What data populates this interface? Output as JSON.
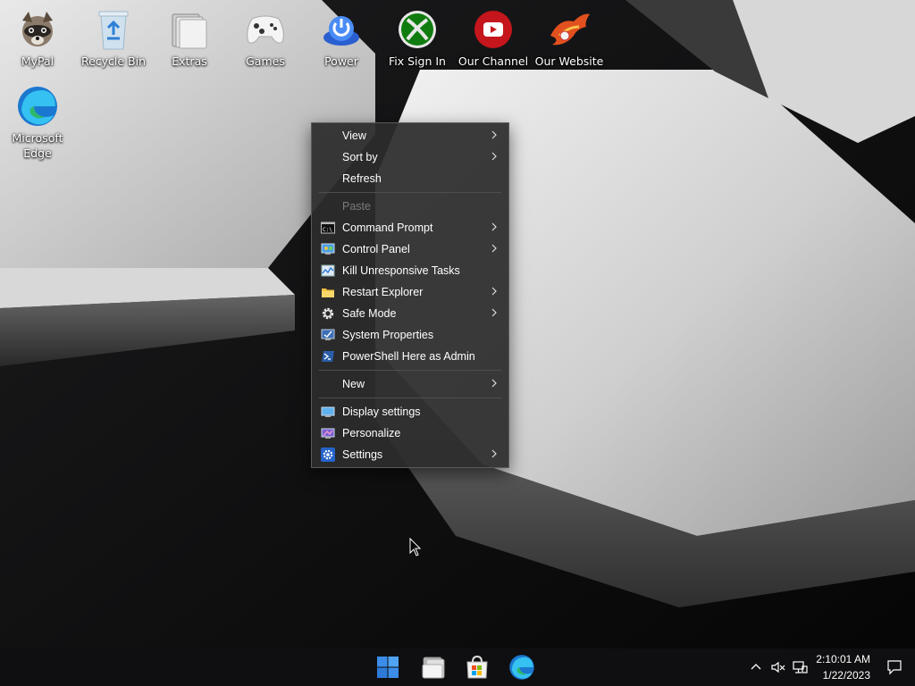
{
  "desktop": {
    "icons": [
      {
        "label": "MyPal",
        "icon": "raccoon-icon"
      },
      {
        "label": "Recycle Bin",
        "icon": "recycle-bin-icon"
      },
      {
        "label": "Extras",
        "icon": "folder-stack-icon"
      },
      {
        "label": "Games",
        "icon": "gamepad-icon"
      },
      {
        "label": "Power",
        "icon": "power-button-icon"
      },
      {
        "label": "Fix Sign In",
        "icon": "xbox-icon"
      },
      {
        "label": "Our Channel",
        "icon": "youtube-icon"
      },
      {
        "label": "Our Website",
        "icon": "phoenix-icon"
      },
      {
        "label": "Microsoft Edge",
        "icon": "edge-icon"
      }
    ]
  },
  "context_menu": {
    "items": [
      {
        "label": "View",
        "submenu": true
      },
      {
        "label": "Sort by",
        "submenu": true
      },
      {
        "label": "Refresh",
        "submenu": false
      },
      {
        "label": "Paste",
        "submenu": false,
        "disabled": true
      },
      {
        "label": "Command Prompt",
        "icon": "command-prompt-icon",
        "submenu": true
      },
      {
        "label": "Control Panel",
        "icon": "control-panel-icon",
        "submenu": true
      },
      {
        "label": "Kill Unresponsive Tasks",
        "icon": "task-monitor-icon",
        "submenu": false
      },
      {
        "label": "Restart Explorer",
        "icon": "folder-icon",
        "submenu": true
      },
      {
        "label": "Safe Mode",
        "icon": "gear-icon",
        "submenu": true
      },
      {
        "label": "System Properties",
        "icon": "system-properties-icon",
        "submenu": false
      },
      {
        "label": "PowerShell Here as Admin",
        "icon": "powershell-icon",
        "submenu": false
      },
      {
        "label": "New",
        "submenu": true
      },
      {
        "label": "Display settings",
        "icon": "display-icon",
        "submenu": false
      },
      {
        "label": "Personalize",
        "icon": "personalize-icon",
        "submenu": false
      },
      {
        "label": "Settings",
        "icon": "settings-gear-icon",
        "submenu": true
      }
    ]
  },
  "taskbar": {
    "pinned": [
      "windows-start-icon",
      "file-explorer-icon",
      "microsoft-store-icon",
      "edge-icon"
    ],
    "tray": [
      "chevron-up-icon",
      "volume-muted-icon",
      "network-icon"
    ],
    "clock": {
      "time": "2:10:01 AM",
      "date": "1/22/2023"
    }
  }
}
